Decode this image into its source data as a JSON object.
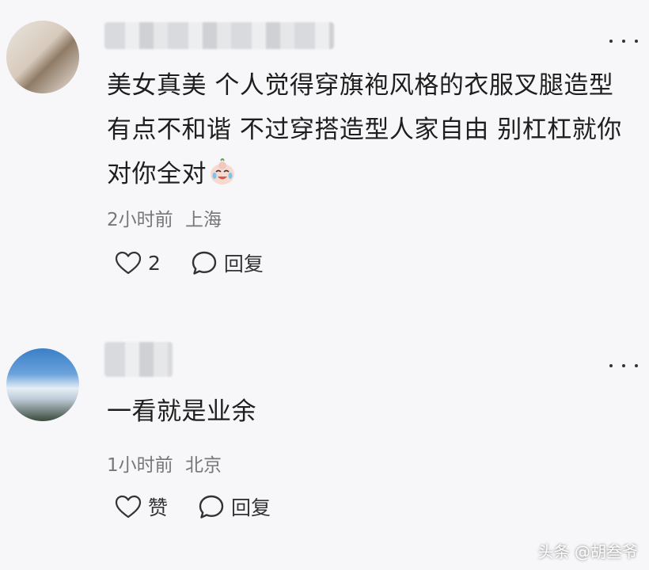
{
  "comments": [
    {
      "text": "美女真美 个人觉得穿旗袍风格的衣服叉腿造型有点不和谐 不过穿搭造型人家自由 别杠杠就你对你全对",
      "emoji": "crying-laughing-emoji",
      "time": "2小时前",
      "location": "上海",
      "like_count": "2",
      "reply_label": "回复"
    },
    {
      "text": "一看就是业余",
      "time": "1小时前",
      "location": "北京",
      "like_label": "赞",
      "reply_label": "回复"
    }
  ],
  "watermark": "头条 @胡叁爷"
}
